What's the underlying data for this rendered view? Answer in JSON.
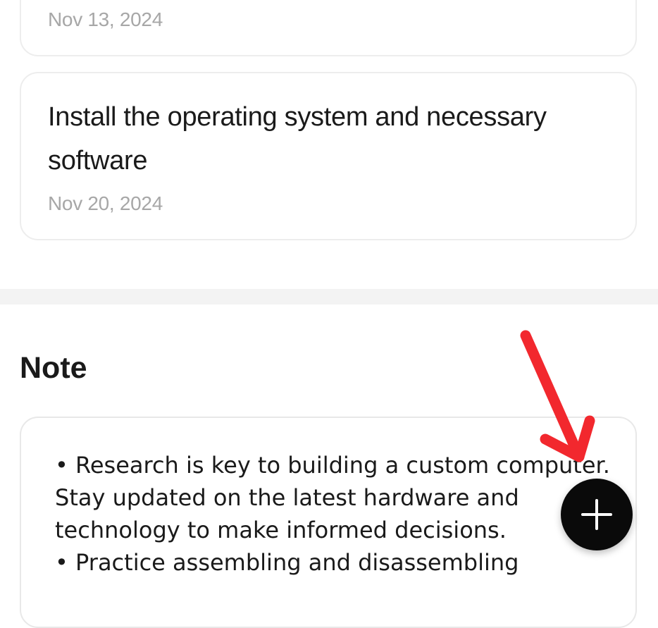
{
  "tasks": [
    {
      "date": "Nov 13, 2024"
    },
    {
      "title": "Install the operating system and necessary software",
      "date": "Nov 20, 2024"
    }
  ],
  "note_section": {
    "title": "Note",
    "content": "• Research is key to building a custom computer. Stay updated on the latest hardware and technology to make informed decisions.\n• Practice assembling and disassembling"
  },
  "fab": {
    "icon": "plus-icon",
    "color": "#0a0a0a"
  },
  "annotation": {
    "icon": "red-arrow-icon",
    "color": "#f2282e"
  }
}
